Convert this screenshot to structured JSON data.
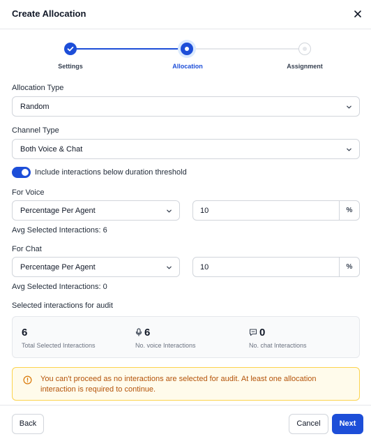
{
  "dialog": {
    "title": "Create Allocation"
  },
  "stepper": {
    "steps": [
      {
        "label": "Settings",
        "status": "completed"
      },
      {
        "label": "Allocation",
        "status": "active"
      },
      {
        "label": "Assignment",
        "status": "pending"
      }
    ]
  },
  "allocation_type": {
    "label": "Allocation Type",
    "value": "Random"
  },
  "channel_type": {
    "label": "Channel Type",
    "value": "Both Voice & Chat"
  },
  "duration_toggle": {
    "label": "Include interactions below duration threshold",
    "on": true
  },
  "voice": {
    "label": "For Voice",
    "method": "Percentage Per Agent",
    "amount": "10",
    "unit": "%",
    "avg_text": "Avg Selected Interactions: 6"
  },
  "chat": {
    "label": "For Chat",
    "method": "Percentage Per Agent",
    "amount": "10",
    "unit": "%",
    "avg_text": "Avg Selected Interactions: 0"
  },
  "audit": {
    "label": "Selected interactions for audit",
    "stats": [
      {
        "value": "6",
        "caption": "Total Selected Interactions",
        "icon": ""
      },
      {
        "value": "6",
        "caption": "No. voice Interactions",
        "icon": "microphone-icon"
      },
      {
        "value": "0",
        "caption": "No. chat Interactions",
        "icon": "chat-bubble-icon"
      }
    ]
  },
  "alert": {
    "message": "You can't proceed as no interactions are selected for audit. At least one allocation interaction is required to continue.",
    "icon": "info-circle-icon"
  },
  "footer": {
    "back_label": "Back",
    "cancel_label": "Cancel",
    "next_label": "Next"
  },
  "colors": {
    "primary": "#1d4ed8",
    "warning_text": "#b45309",
    "warning_bg": "#fffbeb",
    "warning_border": "#fcd34d"
  }
}
